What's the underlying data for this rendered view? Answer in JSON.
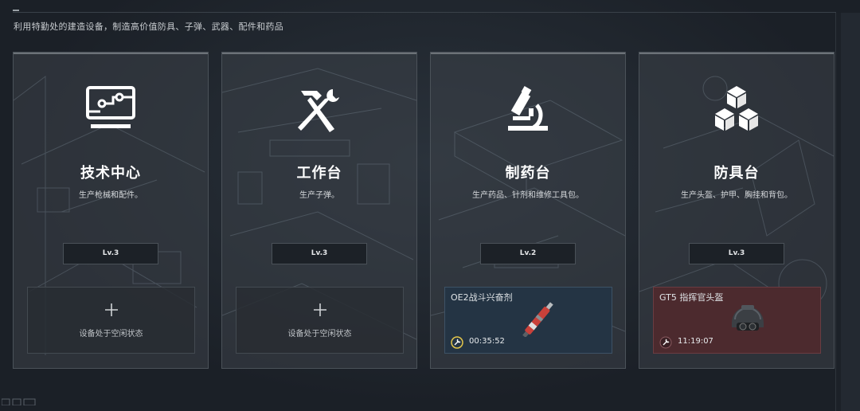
{
  "header": {
    "subtitle": "利用特勤处的建造设备，制造高价值防具、子弹、武器、配件和药品"
  },
  "stations": [
    {
      "name": "技术中心",
      "desc": "生产枪械和配件。",
      "level": "Lv.3",
      "icon": "monitor-circuit-icon",
      "slot": {
        "state": "idle",
        "text": "设备处于空闲状态"
      }
    },
    {
      "name": "工作台",
      "desc": "生产子弹。",
      "level": "Lv.3",
      "icon": "hammer-wrench-icon",
      "slot": {
        "state": "idle",
        "text": "设备处于空闲状态"
      }
    },
    {
      "name": "制药台",
      "desc": "生产药品、针剂和维修工具包。",
      "level": "Lv.2",
      "icon": "microscope-icon",
      "slot": {
        "state": "active",
        "item": "OE2战斗兴奋剂",
        "timer": "00:35:52",
        "color": "#243444"
      }
    },
    {
      "name": "防具台",
      "desc": "生产头盔、护甲、胸挂和背包。",
      "level": "Lv.3",
      "icon": "cubes-icon",
      "slot": {
        "state": "active",
        "item": "GT5 指挥官头盔",
        "timer": "11:19:07",
        "color": "#4c2a2e"
      }
    }
  ]
}
